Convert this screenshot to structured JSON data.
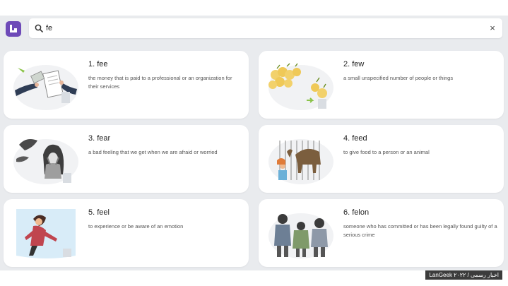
{
  "search": {
    "value": "fe",
    "clear_label": "×"
  },
  "results": [
    {
      "number": "1.",
      "word": "fee",
      "definition": "the money that is paid to a professional or an organization for their services"
    },
    {
      "number": "2.",
      "word": "few",
      "definition": "a small unspecified number of people or things"
    },
    {
      "number": "3.",
      "word": "fear",
      "definition": "a bad feeling that we get when we are afraid or worried"
    },
    {
      "number": "4.",
      "word": "feed",
      "definition": "to give food to a person or an animal"
    },
    {
      "number": "5.",
      "word": "feel",
      "definition": "to experience or be aware of an emotion"
    },
    {
      "number": "6.",
      "word": "felon",
      "definition": "someone who has committed or has been legally found guilty of a serious crime"
    }
  ],
  "watermark": "LanGeek ۲۰۲۲ / اخبار رسمی",
  "colors": {
    "brand": "#6e4ab8",
    "background": "#e9ebee",
    "card": "#ffffff"
  }
}
